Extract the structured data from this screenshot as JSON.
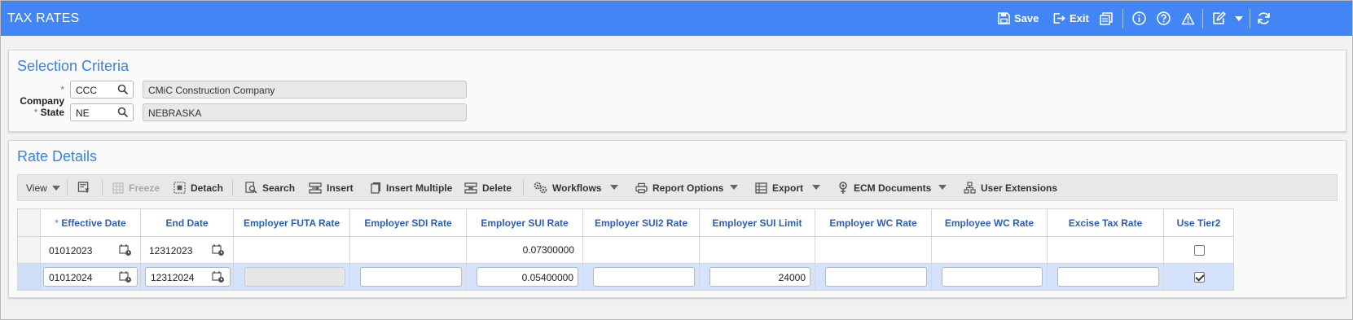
{
  "window": {
    "title": "TAX RATES"
  },
  "header_toolbar": {
    "save_label": "Save",
    "exit_label": "Exit"
  },
  "selection": {
    "title": "Selection Criteria",
    "required_mark": "*",
    "company": {
      "label": "Company",
      "code": "CCC",
      "name": "CMiC Construction Company"
    },
    "state": {
      "label": "State",
      "code": "NE",
      "name": "NEBRASKA"
    }
  },
  "rate_details": {
    "title": "Rate Details",
    "toolbar": {
      "view": "View",
      "freeze": "Freeze",
      "detach": "Detach",
      "search": "Search",
      "insert": "Insert",
      "insert_multiple": "Insert Multiple",
      "delete": "Delete",
      "workflows": "Workflows",
      "report_options": "Report Options",
      "export": "Export",
      "ecm_documents": "ECM Documents",
      "user_extensions": "User Extensions"
    },
    "columns": {
      "effective_date": "Effective Date",
      "end_date": "End Date",
      "futa": "Employer FUTA Rate",
      "sdi": "Employer SDI Rate",
      "sui": "Employer SUI Rate",
      "sui2": "Employer SUI2 Rate",
      "sui_limit": "Employer SUI Limit",
      "er_wc": "Employer WC Rate",
      "ee_wc": "Employee WC Rate",
      "excise": "Excise Tax Rate",
      "tier2": "Use Tier2"
    },
    "rows": [
      {
        "effective_date": "01012023",
        "end_date": "12312023",
        "futa": "",
        "sdi": "",
        "sui": "0.07300000",
        "sui2": "",
        "sui_limit": "",
        "er_wc": "",
        "ee_wc": "",
        "excise": "",
        "tier2": false
      },
      {
        "effective_date": "01012024",
        "end_date": "12312024",
        "futa": "",
        "sdi": "",
        "sui": "0.05400000",
        "sui2": "",
        "sui_limit": "24000",
        "er_wc": "",
        "ee_wc": "",
        "excise": "",
        "tier2": true
      }
    ]
  },
  "colors": {
    "titlebar": "#4285f4",
    "accent": "#3b82e0",
    "header_text": "#2c5fb3",
    "selected_row": "#d4e3fb"
  }
}
